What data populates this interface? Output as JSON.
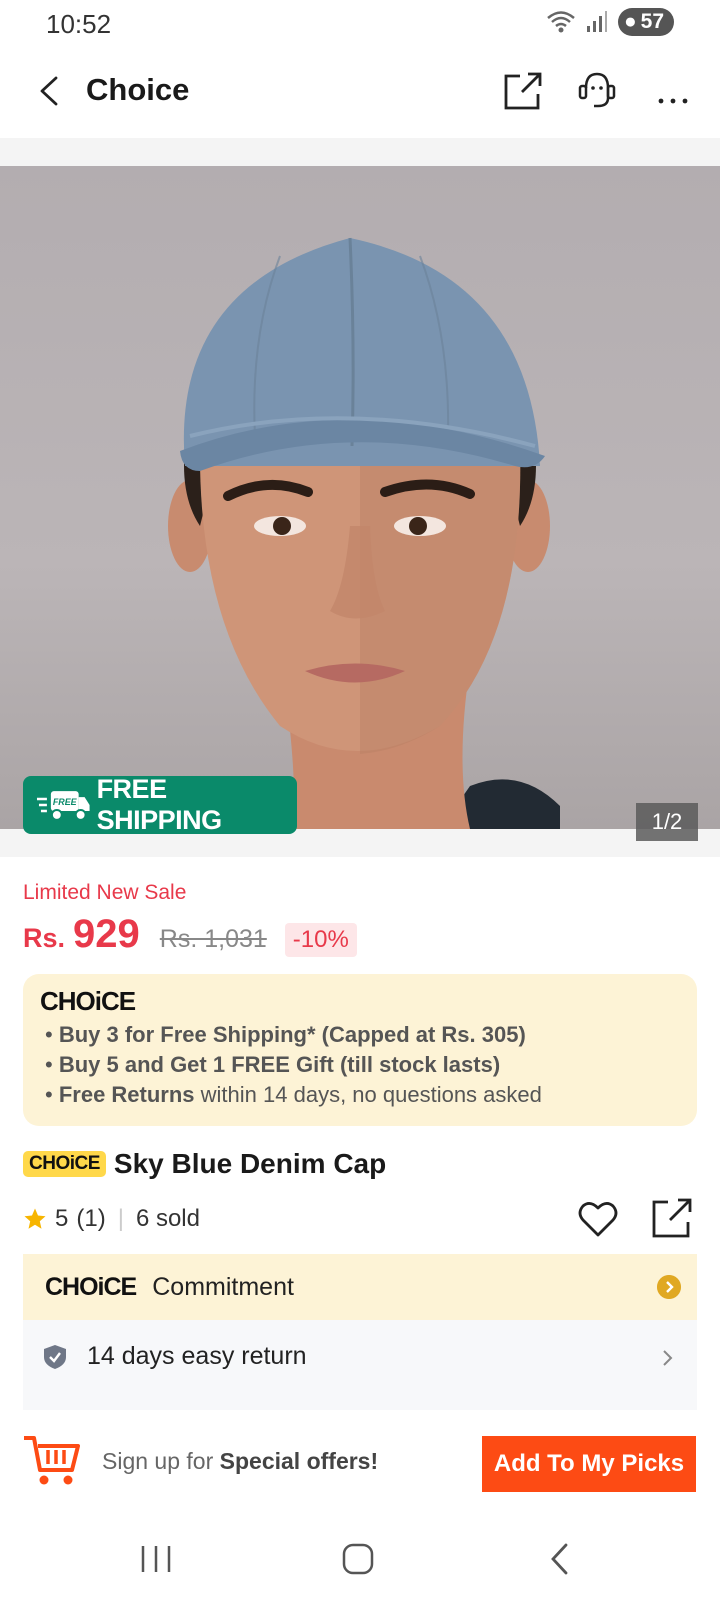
{
  "status_bar": {
    "time": "10:52",
    "battery": "57"
  },
  "header": {
    "title": "Choice"
  },
  "gallery": {
    "badge_text": "FREE SHIPPING",
    "badge_icon_text": "FREE",
    "counter": "1/2"
  },
  "price": {
    "sale_label": "Limited New Sale",
    "currency": "Rs.",
    "current": "929",
    "original": "Rs. 1,031",
    "discount": "-10%"
  },
  "choice_box": {
    "logo": "CHOiCE",
    "perks": [
      {
        "bold": "Buy 3 for  Free Shipping* (Capped at Rs. 305)",
        "rest": ""
      },
      {
        "bold": "Buy 5 and Get 1 FREE Gift (till stock lasts)",
        "rest": ""
      },
      {
        "bold": "Free Returns",
        "rest": " within 14 days, no questions asked"
      }
    ]
  },
  "product": {
    "tag": "CHOiCE",
    "title": "Sky Blue Denim Cap",
    "rating": "5",
    "rating_count": "(1)",
    "sold": "6 sold"
  },
  "commitment": {
    "logo": "CHOiCE",
    "label": "Commitment"
  },
  "returns": {
    "label": "14 days easy return"
  },
  "bottom_bar": {
    "signup_prefix": "Sign up for ",
    "signup_bold": "Special offers!",
    "add_button": "Add To My Picks"
  },
  "colors": {
    "accent": "#fd4b14",
    "price": "#e8394a",
    "shipping_badge": "#0a8a6a",
    "choice_bg": "#fdf3d6"
  }
}
